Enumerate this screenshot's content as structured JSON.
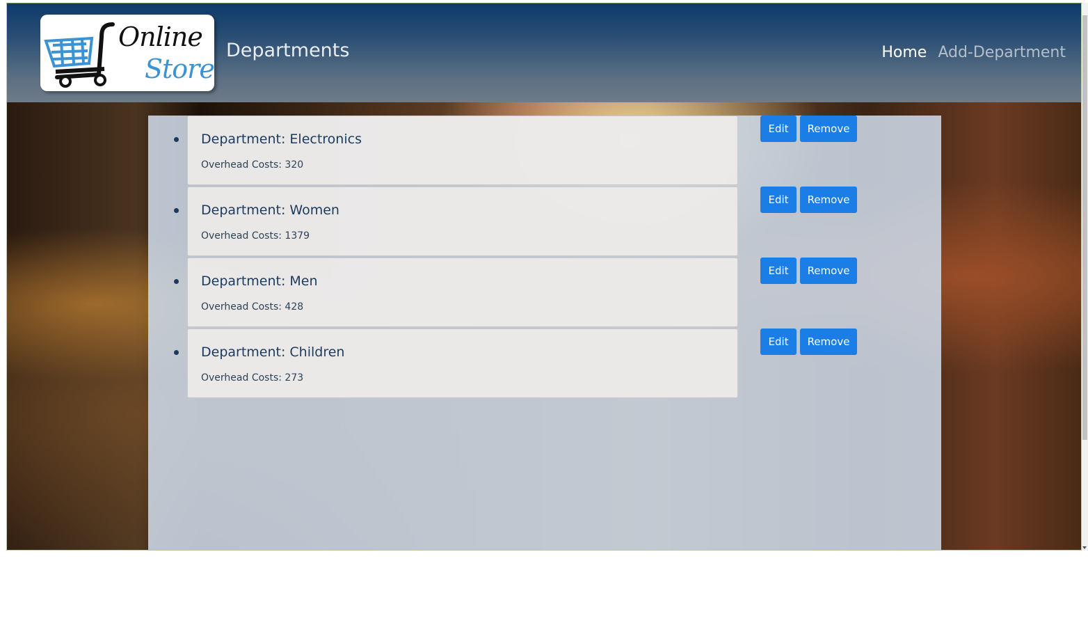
{
  "header": {
    "logo": {
      "line1": "Online",
      "line2": "Store"
    },
    "title": "Departments",
    "nav": {
      "home": "Home",
      "add_department": "Add-Department"
    }
  },
  "departments": [
    {
      "name": "Department: Electronics",
      "cost": "Overhead Costs: 320",
      "edit": "Edit",
      "remove": "Remove"
    },
    {
      "name": "Department: Women",
      "cost": "Overhead Costs: 1379",
      "edit": "Edit",
      "remove": "Remove"
    },
    {
      "name": "Department: Men",
      "cost": "Overhead Costs: 428",
      "edit": "Edit",
      "remove": "Remove"
    },
    {
      "name": "Department: Children",
      "cost": "Overhead Costs: 273",
      "edit": "Edit",
      "remove": "Remove"
    }
  ],
  "colors": {
    "header_top": "#0d3a6a",
    "button": "#1a7ee6",
    "heading_text": "#1c3a5e",
    "logo_store": "#3b93d4"
  },
  "icons": {
    "logo": "shopping-cart-icon"
  }
}
